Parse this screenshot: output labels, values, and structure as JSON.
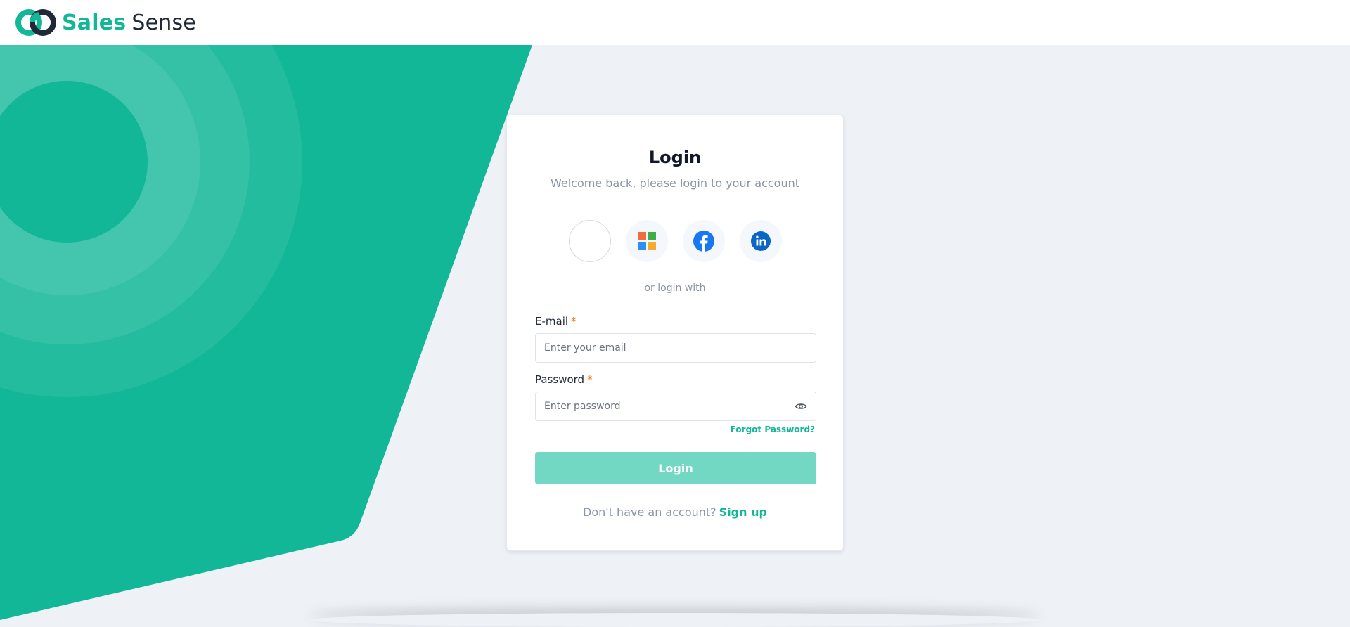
{
  "app": {
    "brand_primary": "Sales",
    "brand_secondary": "Sense",
    "accent_color": "#12b797"
  },
  "login": {
    "title": "Login",
    "subtitle": "Welcome back, please login to your account",
    "social_icons": [
      "blank-provider-icon",
      "microsoft-icon",
      "facebook-icon",
      "linkedin-icon"
    ],
    "or_text": "or login with",
    "email_label": "E-mail",
    "email_required": "*",
    "email_placeholder": "Enter your email",
    "email_value": "",
    "password_label": "Password",
    "password_required": "*",
    "password_placeholder": "Enter password",
    "password_value": "",
    "forgot_label": "Forgot Password?",
    "submit_label": "Login",
    "no_account_text": "Don't have an account?",
    "signup_label": "Sign up"
  }
}
